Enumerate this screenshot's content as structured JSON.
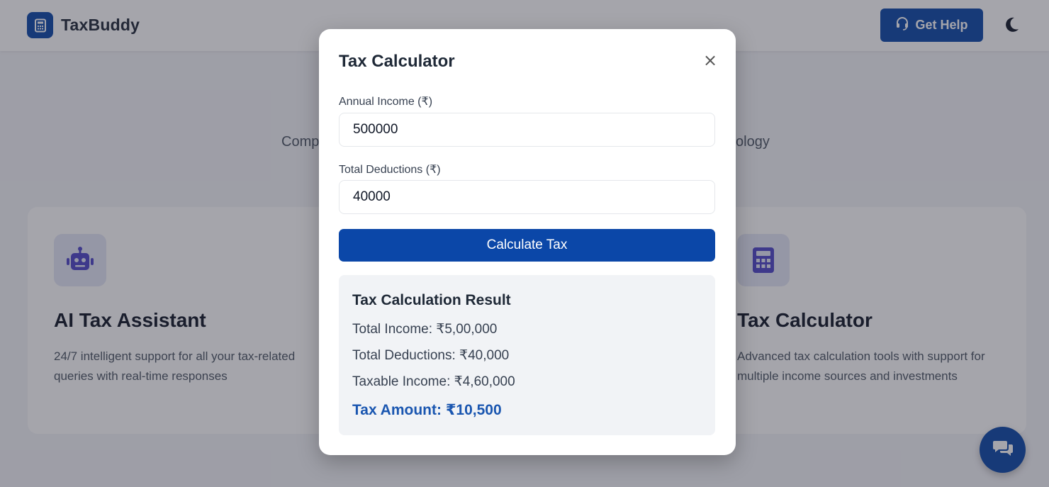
{
  "navbar": {
    "brand": "TaxBuddy",
    "help_label": "Get Help"
  },
  "hero": {
    "left_fragment": "Comp",
    "right_fragment": "ology"
  },
  "features": [
    {
      "title": "AI Tax Assistant",
      "description": "24/7 intelligent support for all your tax-related queries with real-time responses",
      "icon": "robot-icon"
    },
    {
      "title": "Tax Calculator",
      "description": "Advanced tax calculation tools with support for multiple income sources and investments",
      "icon": "calculator-icon"
    }
  ],
  "modal": {
    "title": "Tax Calculator",
    "close_label": "×",
    "income_label": "Annual Income (₹)",
    "income_value": "500000",
    "deductions_label": "Total Deductions (₹)",
    "deductions_value": "40000",
    "calculate_label": "Calculate Tax",
    "result": {
      "title": "Tax Calculation Result",
      "total_income": "Total Income: ₹5,00,000",
      "total_deductions": "Total Deductions: ₹40,000",
      "taxable_income": "Taxable Income: ₹4,60,000",
      "tax_amount": "Tax Amount: ₹10,500"
    }
  },
  "colors": {
    "primary": "#0b47a8",
    "accent_text": "#1a56b0",
    "overlay": "rgba(40,40,56,0.42)"
  }
}
